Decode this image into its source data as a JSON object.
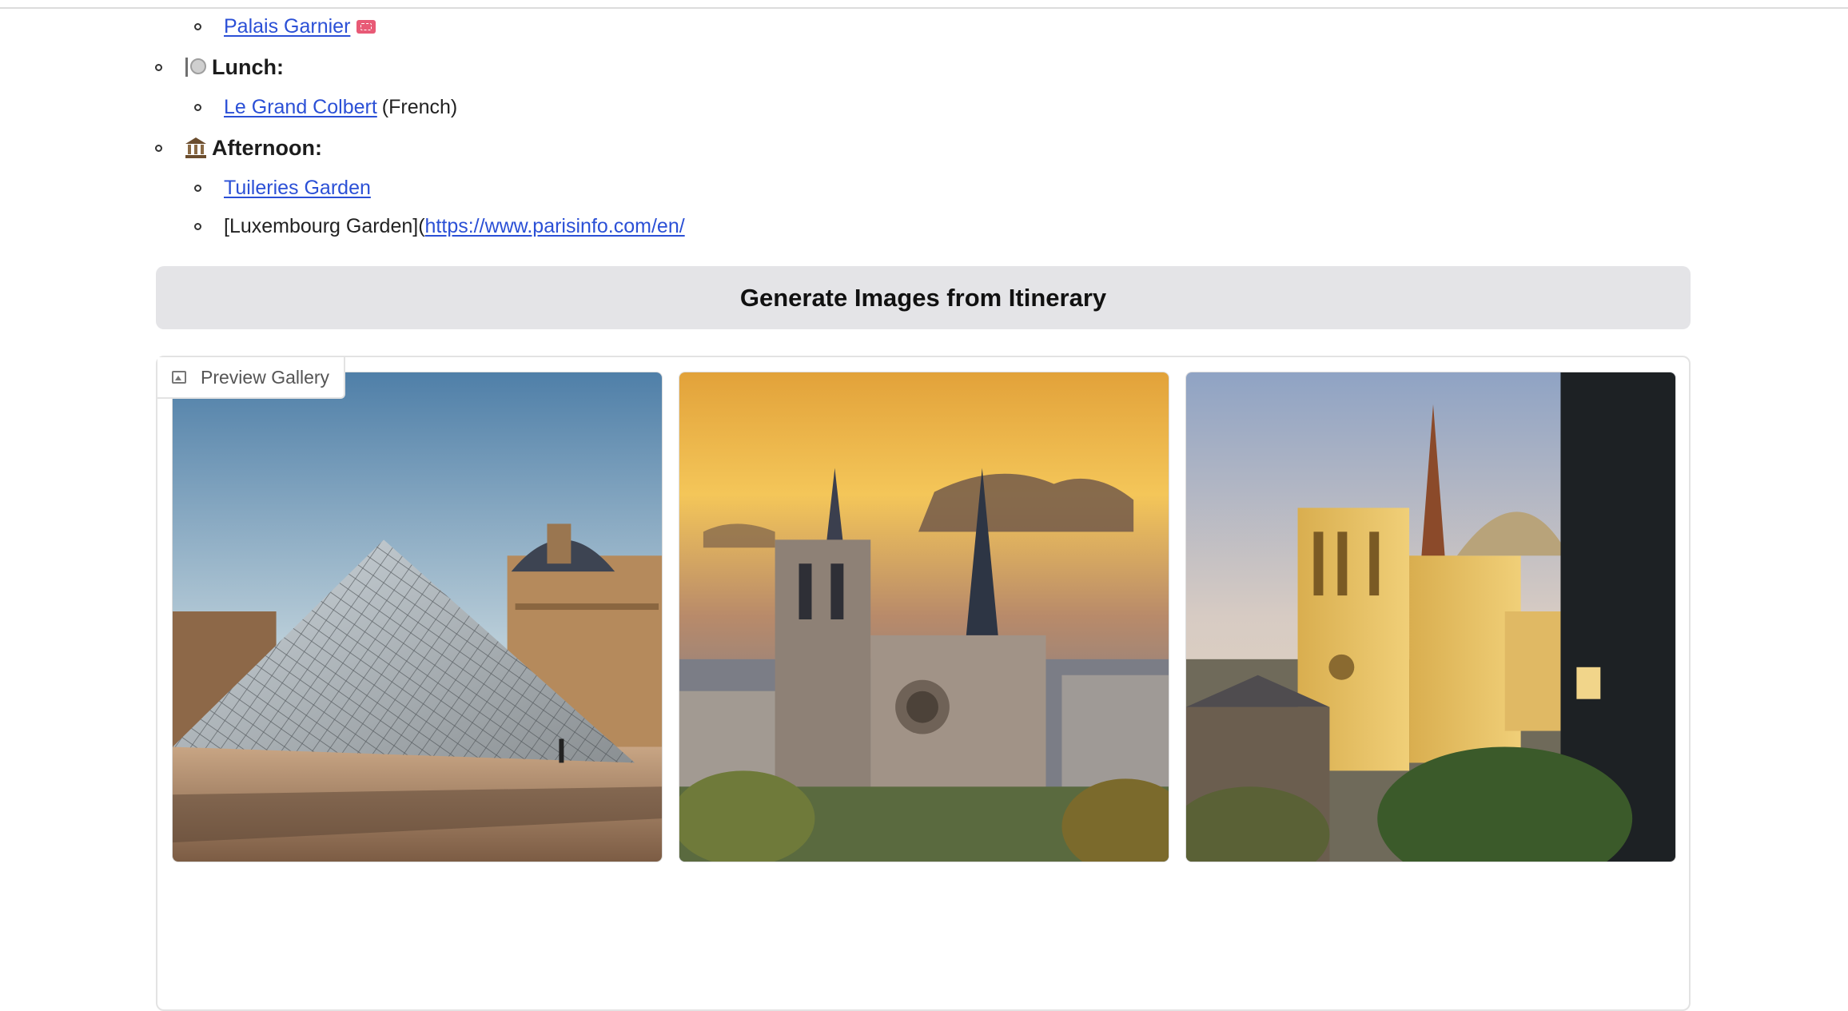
{
  "itinerary": {
    "palais_link": "Palais Garnier",
    "lunch_heading": "Lunch:",
    "lunch_link": "Le Grand Colbert",
    "lunch_note": "(French)",
    "afternoon_heading": "Afternoon:",
    "tuileries_link": "Tuileries Garden",
    "luxembourg_prefix": "[Luxembourg Garden](",
    "luxembourg_url": "https://www.parisinfo.com/en/"
  },
  "icons": {
    "palais": "ticket-icon",
    "lunch": "fork-and-plate-icon",
    "afternoon": "classical-building-icon",
    "gallery": "image-icon"
  },
  "generate_button": {
    "label": "Generate Images from Itinerary"
  },
  "gallery": {
    "label": "Preview Gallery",
    "images": [
      {
        "subject": "louvre-pyramid"
      },
      {
        "subject": "notre-dame-sunset"
      },
      {
        "subject": "notre-dame-golden"
      }
    ]
  },
  "colors": {
    "link": "#2b50d6",
    "button_bg": "#e4e4e7",
    "border": "#e3e3e3"
  }
}
